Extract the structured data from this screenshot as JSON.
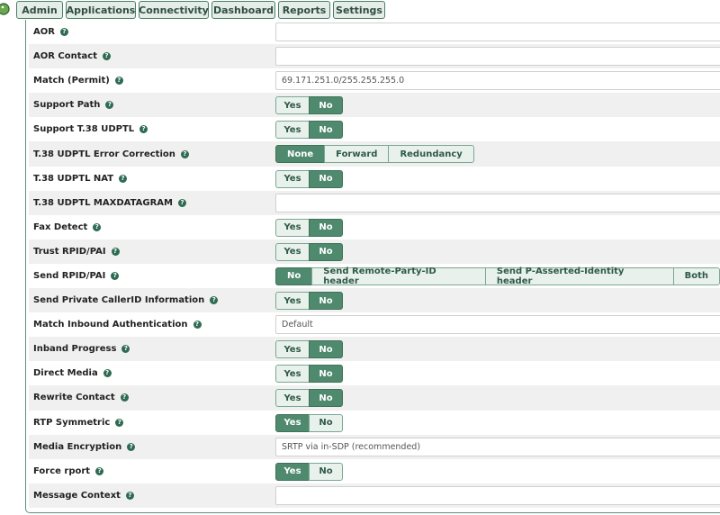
{
  "nav": {
    "items": [
      "Admin",
      "Applications",
      "Connectivity",
      "Dashboard",
      "Reports",
      "Settings"
    ]
  },
  "form": {
    "rows": [
      {
        "label": "AOR",
        "type": "text",
        "value": ""
      },
      {
        "label": "AOR Contact",
        "type": "text",
        "value": ""
      },
      {
        "label": "Match (Permit)",
        "type": "text",
        "value": "69.171.251.0/255.255.255.0"
      },
      {
        "label": "Support Path",
        "type": "toggle",
        "options": [
          "Yes",
          "No"
        ],
        "selected": "No"
      },
      {
        "label": "Support T.38 UDPTL",
        "type": "toggle",
        "options": [
          "Yes",
          "No"
        ],
        "selected": "No"
      },
      {
        "label": "T.38 UDPTL Error Correction",
        "type": "toggle",
        "options": [
          "None",
          "Forward",
          "Redundancy"
        ],
        "selected": "None"
      },
      {
        "label": "T.38 UDPTL NAT",
        "type": "toggle",
        "options": [
          "Yes",
          "No"
        ],
        "selected": "No"
      },
      {
        "label": "T.38 UDPTL MAXDATAGRAM",
        "type": "text",
        "value": ""
      },
      {
        "label": "Fax Detect",
        "type": "toggle",
        "options": [
          "Yes",
          "No"
        ],
        "selected": "No"
      },
      {
        "label": "Trust RPID/PAI",
        "type": "toggle",
        "options": [
          "Yes",
          "No"
        ],
        "selected": "No"
      },
      {
        "label": "Send RPID/PAI",
        "type": "toggle",
        "options": [
          "No",
          "Send Remote-Party-ID header",
          "Send P-Asserted-Identity header",
          "Both"
        ],
        "selected": "No"
      },
      {
        "label": "Send Private CallerID Information",
        "type": "toggle",
        "options": [
          "Yes",
          "No"
        ],
        "selected": "No"
      },
      {
        "label": "Match Inbound Authentication",
        "type": "select",
        "value": "Default"
      },
      {
        "label": "Inband Progress",
        "type": "toggle",
        "options": [
          "Yes",
          "No"
        ],
        "selected": "No"
      },
      {
        "label": "Direct Media",
        "type": "toggle",
        "options": [
          "Yes",
          "No"
        ],
        "selected": "No"
      },
      {
        "label": "Rewrite Contact",
        "type": "toggle",
        "options": [
          "Yes",
          "No"
        ],
        "selected": "No"
      },
      {
        "label": "RTP Symmetric",
        "type": "toggle",
        "options": [
          "Yes",
          "No"
        ],
        "selected": "Yes"
      },
      {
        "label": "Media Encryption",
        "type": "select",
        "value": "SRTP via in-SDP (recommended)"
      },
      {
        "label": "Force rport",
        "type": "toggle",
        "options": [
          "Yes",
          "No"
        ],
        "selected": "Yes"
      },
      {
        "label": "Message Context",
        "type": "text",
        "value": ""
      }
    ]
  },
  "icons": {
    "logo": "logo-icon",
    "help": "help-icon"
  },
  "colors": {
    "accent": "#4f8a6f",
    "button_bg": "#e8f1ec",
    "row_alt": "#f0f0f0"
  }
}
